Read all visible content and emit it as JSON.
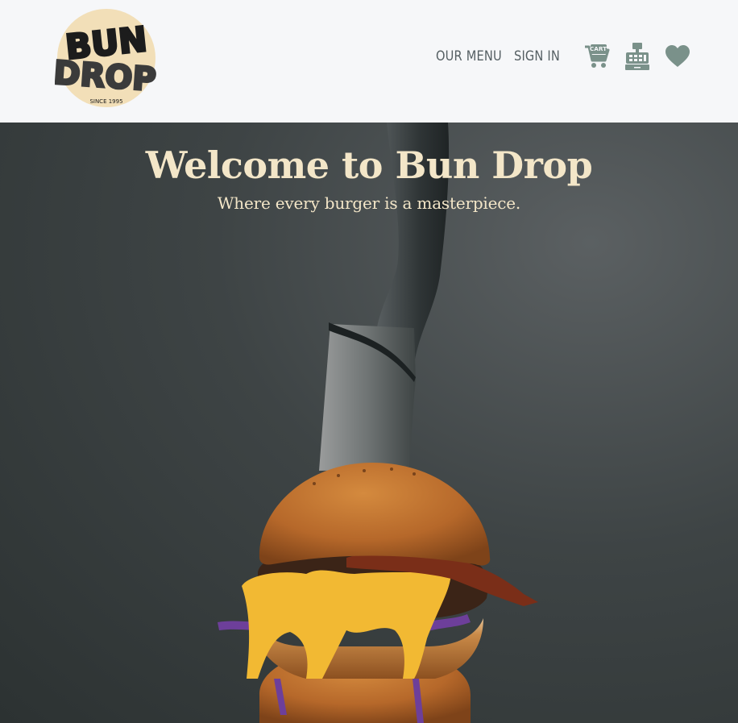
{
  "header": {
    "logo": {
      "line1": "BUN",
      "line2": "DROP",
      "tagline": "SINCE 1995",
      "badge_color": "#f2dfb8",
      "text_color": "#1c1c1c"
    },
    "nav": {
      "menu_label": "OUR MENU",
      "signin_label": "SIGN IN",
      "cart_icon": "cart-icon",
      "cart_label": "CART",
      "checkout_icon": "cash-register-icon",
      "favorites_icon": "heart-icon",
      "icon_color": "#7a918a"
    }
  },
  "hero": {
    "title": "Welcome to Bun Drop",
    "subtitle": "Where every burger is a masterpiece.",
    "text_color": "#f3e6c8"
  }
}
